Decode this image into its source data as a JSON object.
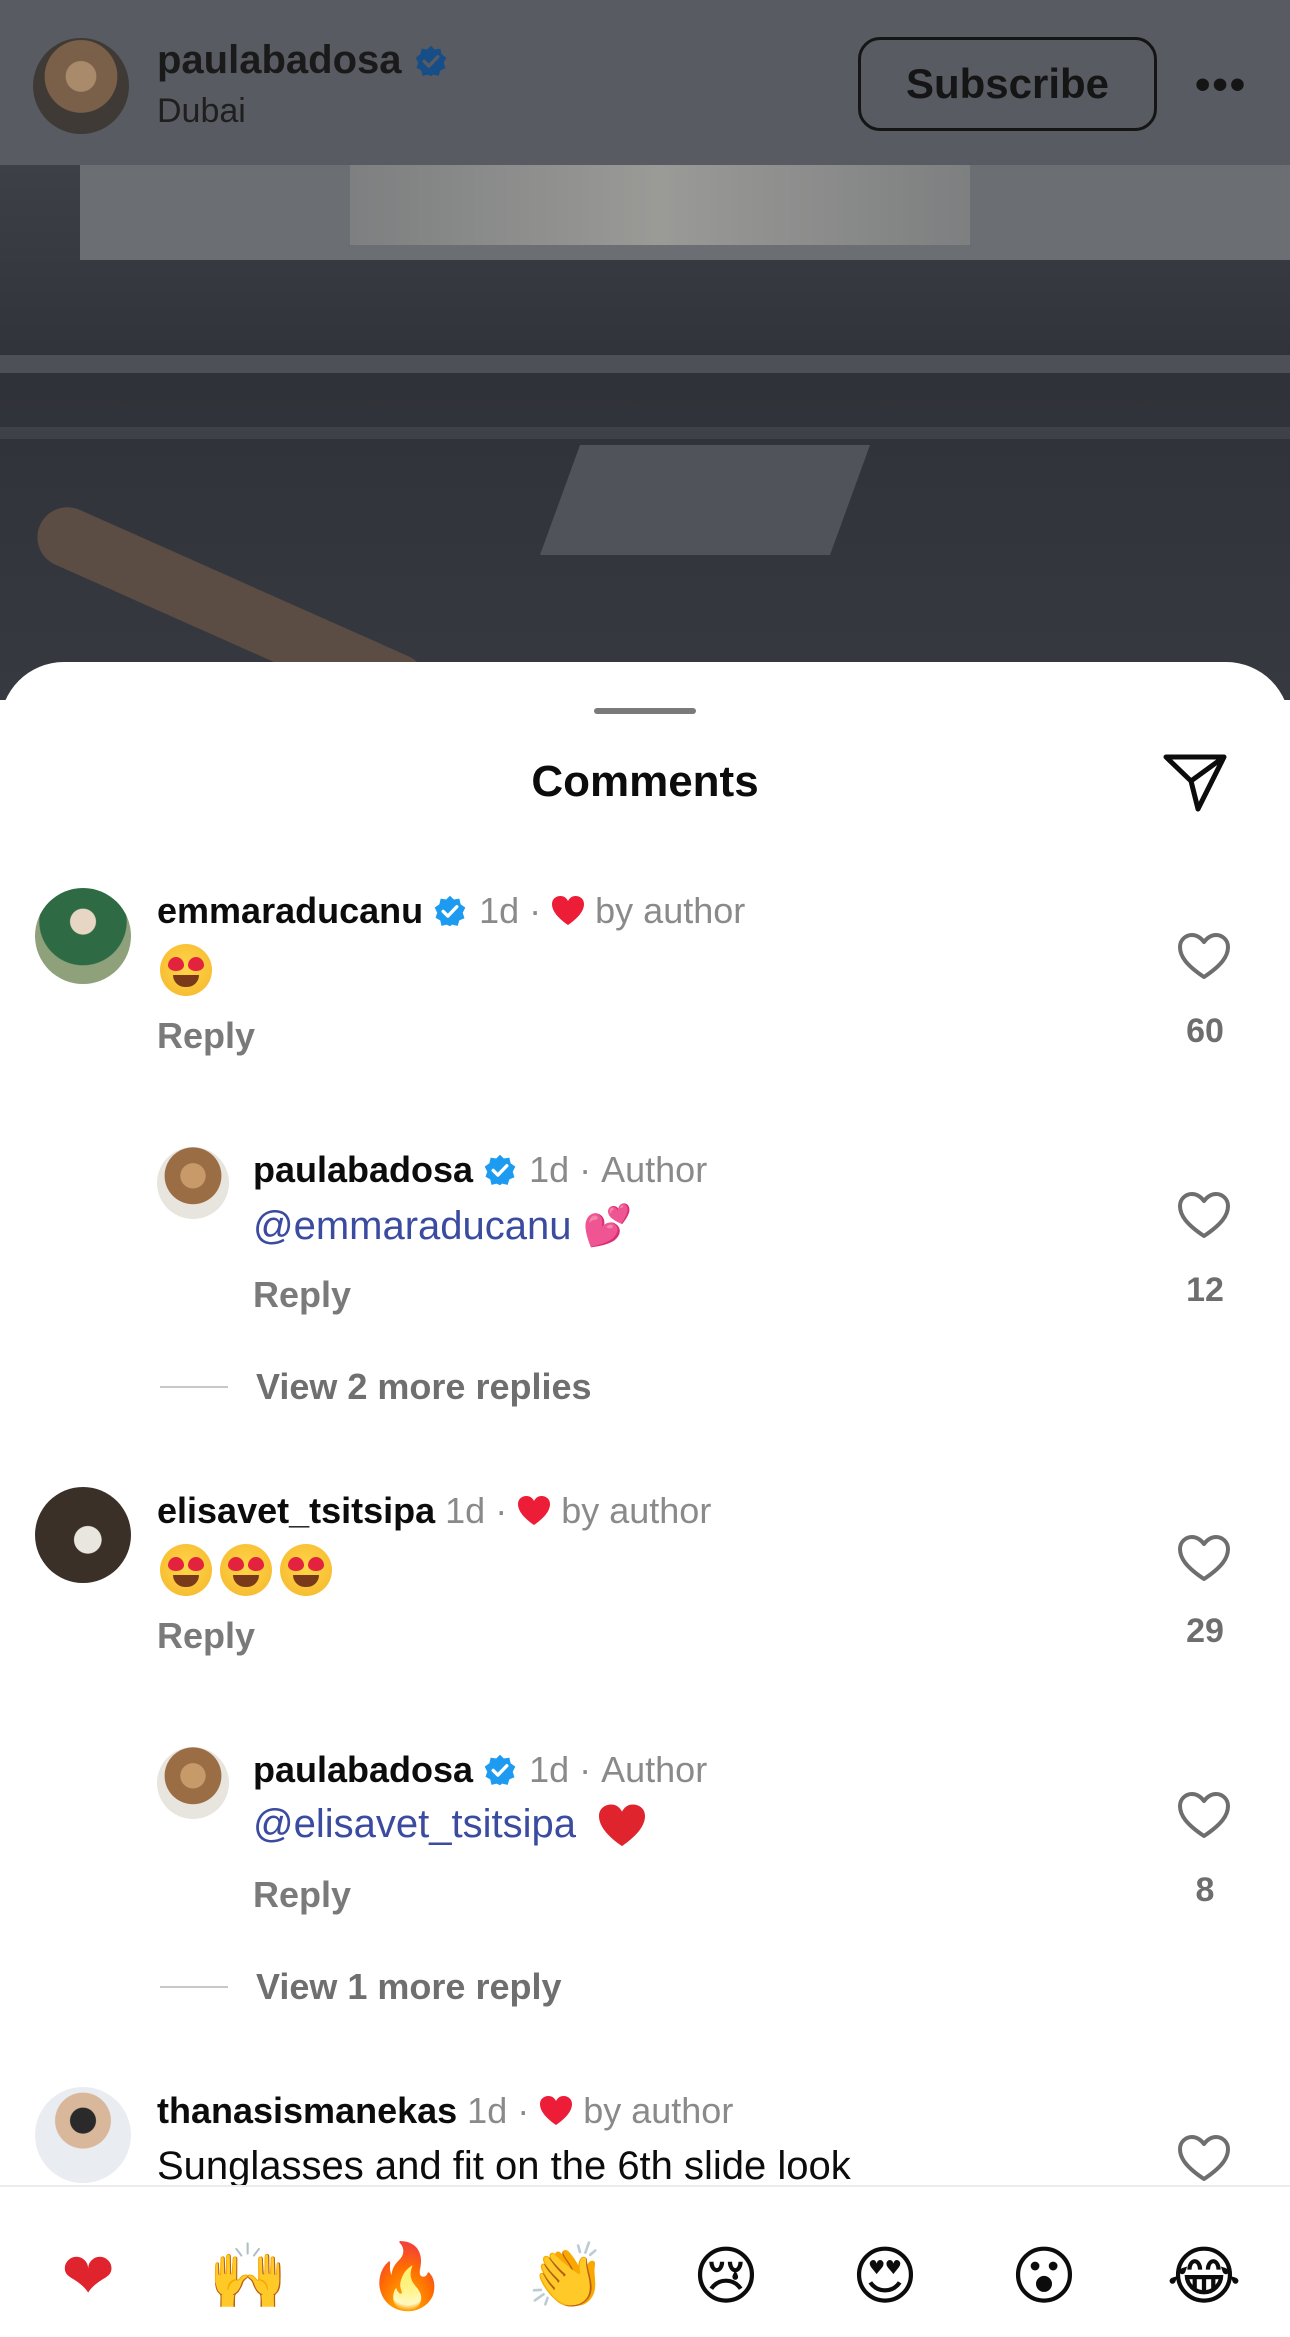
{
  "post": {
    "username": "paulabadosa",
    "location": "Dubai",
    "subscribe_label": "Subscribe",
    "more_label": "•••"
  },
  "sheet": {
    "title": "Comments"
  },
  "comments": [
    {
      "username": "emmaraducanu",
      "time": "1d",
      "liked_by_author": "by author",
      "body_emoji_count": 1,
      "reply_label": "Reply",
      "likes": "60"
    },
    {
      "username": "paulabadosa",
      "time": "1d",
      "role": "Author",
      "mention": "@emmaraducanu",
      "body_emoji": "💕",
      "reply_label": "Reply",
      "likes": "12"
    },
    {
      "view_more": "View 2 more replies"
    },
    {
      "username": "elisavet_tsitsipa",
      "time": "1d",
      "liked_by_author": "by author",
      "body_emoji_count": 3,
      "reply_label": "Reply",
      "likes": "29"
    },
    {
      "username": "paulabadosa",
      "time": "1d",
      "role": "Author",
      "mention": "@elisavet_tsitsipa",
      "body_emoji": "❤",
      "reply_label": "Reply",
      "likes": "8"
    },
    {
      "view_more": "View 1 more reply"
    },
    {
      "username": "thanasismanekas",
      "time": "1d",
      "liked_by_author": "by author",
      "body": "Sunglasses and fit on the 6th slide look"
    }
  ],
  "reactions": [
    "❤",
    "🙌",
    "🔥",
    "👏",
    "😢",
    "😍",
    "😮",
    "😂"
  ],
  "colors": {
    "verified_blue": "#1d9bf0",
    "heart_red": "#ed1c37",
    "mention_blue": "#3b4b9f",
    "dim_overlay": "#585b61"
  }
}
